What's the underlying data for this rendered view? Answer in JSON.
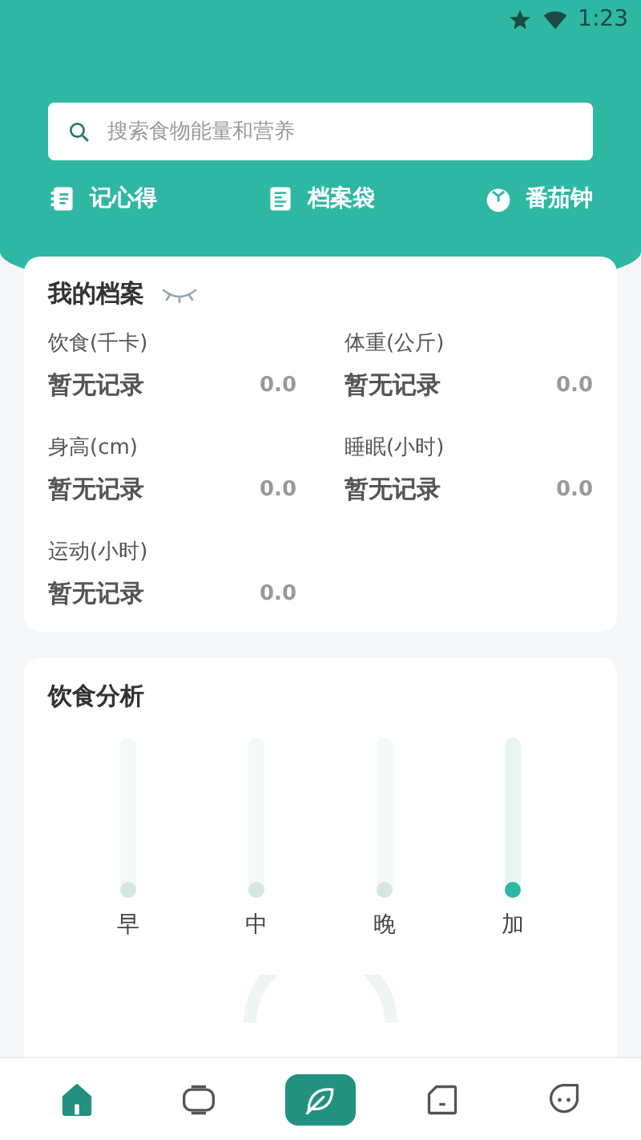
{
  "status_bar": {
    "time": "1:23"
  },
  "search": {
    "placeholder": "搜索食物能量和营养"
  },
  "shortcuts": [
    {
      "kind": "notes",
      "label": "记心得"
    },
    {
      "kind": "folder",
      "label": "档案袋"
    },
    {
      "kind": "timer",
      "label": "番茄钟"
    }
  ],
  "profile": {
    "title": "我的档案",
    "metrics": [
      {
        "label": "饮食(千卡)",
        "status": "暂无记录",
        "value": "0.0"
      },
      {
        "label": "体重(公斤)",
        "status": "暂无记录",
        "value": "0.0"
      },
      {
        "label": "身高(cm)",
        "status": "暂无记录",
        "value": "0.0"
      },
      {
        "label": "睡眠(小时)",
        "status": "暂无记录",
        "value": "0.0"
      },
      {
        "label": "运动(小时)",
        "status": "暂无记录",
        "value": "0.0"
      }
    ]
  },
  "diet": {
    "title": "饮食分析",
    "meals": [
      {
        "label": "早",
        "selected": false
      },
      {
        "label": "中",
        "selected": false
      },
      {
        "label": "晚",
        "selected": false
      },
      {
        "label": "加",
        "selected": true
      }
    ]
  },
  "nav": [
    {
      "kind": "home",
      "selected": true
    },
    {
      "kind": "tv",
      "selected": false
    },
    {
      "kind": "leaf",
      "selected": false
    },
    {
      "kind": "folder",
      "selected": false
    },
    {
      "kind": "face",
      "selected": false
    }
  ]
}
